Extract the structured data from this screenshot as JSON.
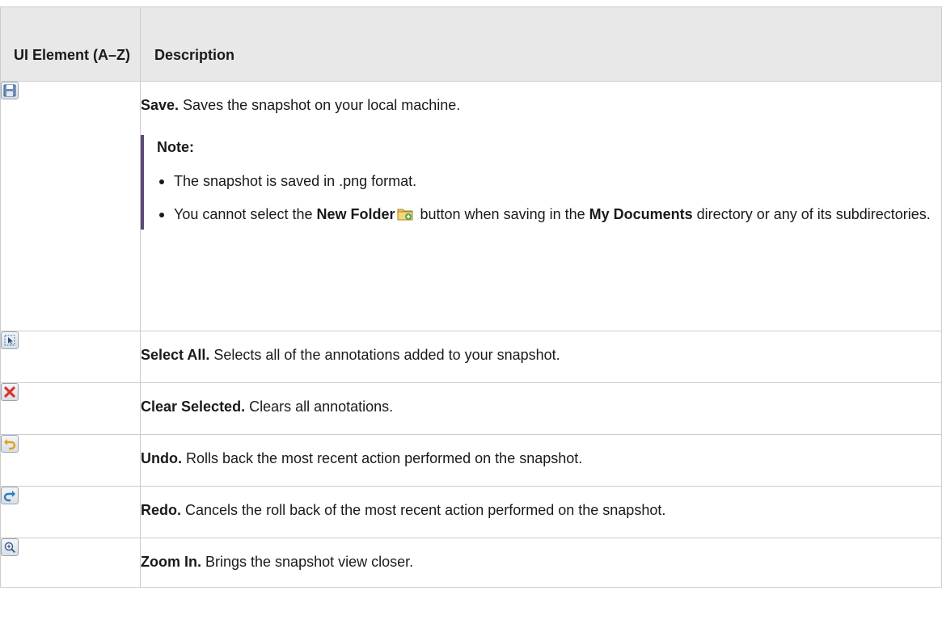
{
  "header": {
    "col1": "UI Element (A–Z)",
    "col2": "Description"
  },
  "rows": [
    {
      "icon": "save-icon",
      "name": "Save.",
      "text": " Saves the snapshot on your local machine.",
      "note": {
        "title": "Note:",
        "item1": "The snapshot is saved in .png format.",
        "item2_before": "You cannot select the ",
        "item2_bold1": "New Folder",
        "item2_mid": " button when saving in the ",
        "item2_bold2": "My Documents",
        "item2_after": " directory or any of its subdirectories."
      }
    },
    {
      "icon": "select-all-icon",
      "name": "Select All.",
      "text": " Selects all of the annotations added to your snapshot."
    },
    {
      "icon": "clear-selected-icon",
      "name": "Clear Selected.",
      "text": " Clears all annotations."
    },
    {
      "icon": "undo-icon",
      "name": "Undo.",
      "text": " Rolls back the most recent action performed on the snapshot."
    },
    {
      "icon": "redo-icon",
      "name": "Redo.",
      "text": " Cancels the roll back of the most recent action performed on the snapshot."
    },
    {
      "icon": "zoom-in-icon",
      "name": "Zoom In.",
      "text": " Brings the snapshot view closer."
    }
  ]
}
